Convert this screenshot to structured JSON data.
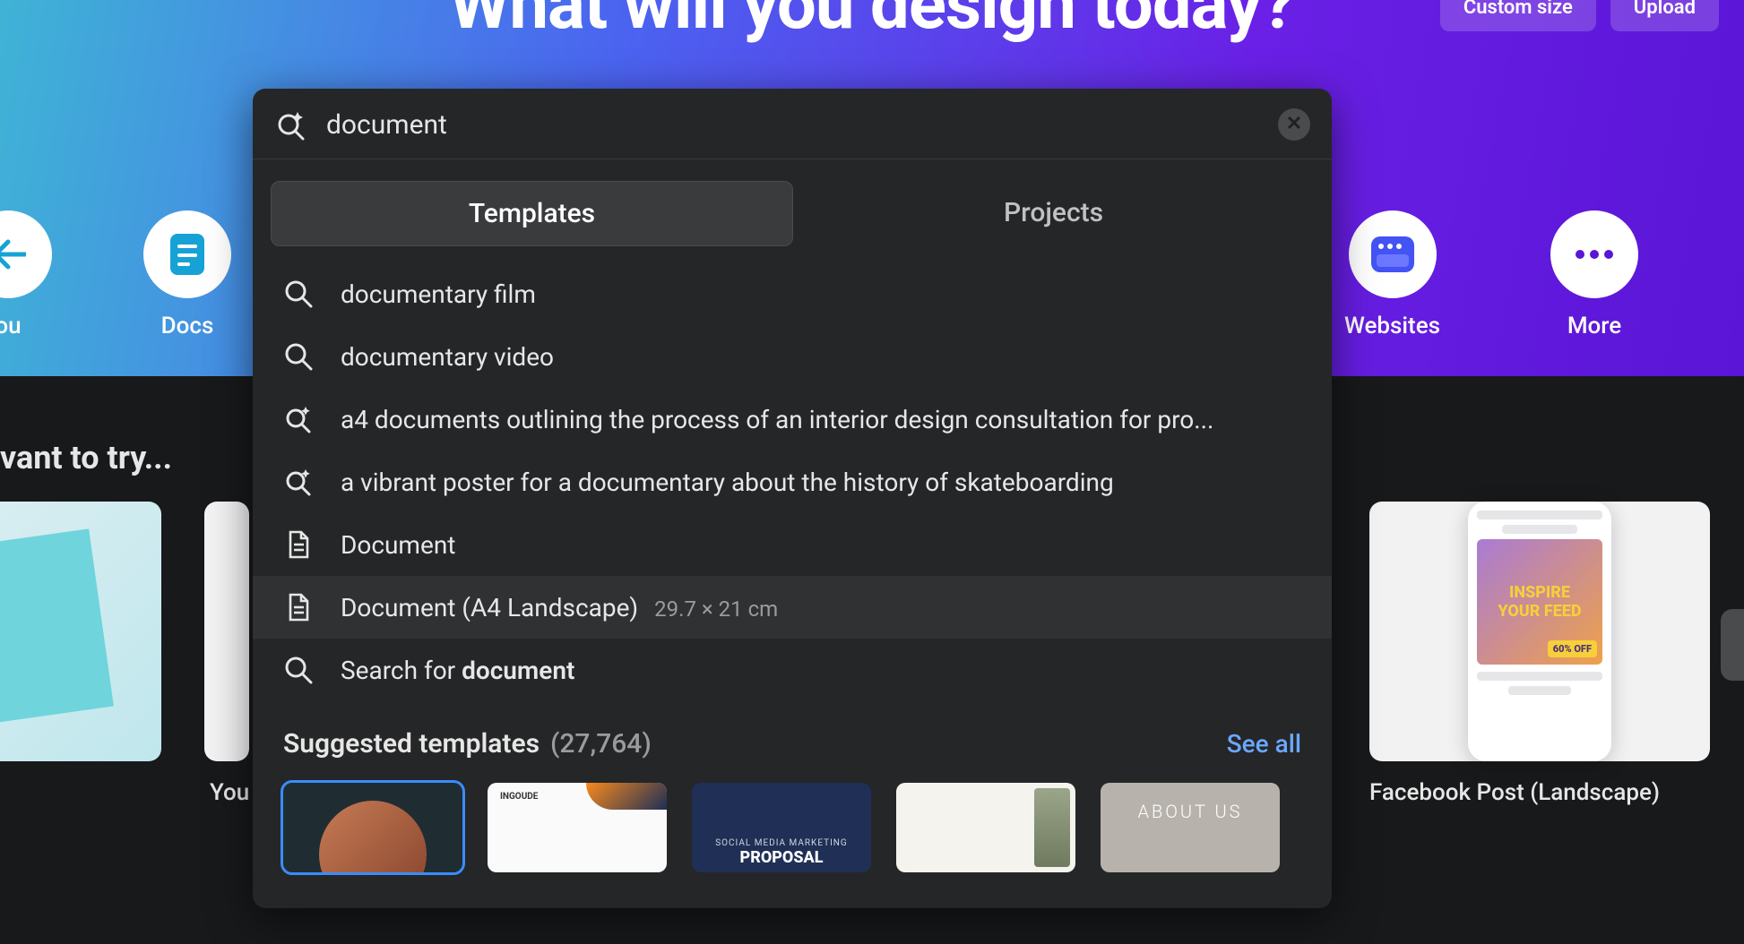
{
  "hero": {
    "title": "What will you design today?",
    "custom_size": "Custom size",
    "upload": "Upload"
  },
  "categories": {
    "you": "ou",
    "docs": "Docs",
    "websites": "Websites",
    "more": "More"
  },
  "section_label": "vant to try...",
  "cards": {
    "b_caption": "You",
    "c_caption": "Facebook Post (Landscape)",
    "phone_line1": "INSPIRE",
    "phone_line2": "YOUR FEED",
    "phone_badge": "60% OFF"
  },
  "search": {
    "value": "document",
    "tabs": {
      "templates": "Templates",
      "projects": "Projects"
    },
    "suggestions": [
      {
        "icon": "search",
        "text": "documentary film"
      },
      {
        "icon": "search",
        "text": "documentary video"
      },
      {
        "icon": "sparkle",
        "text": "a4 documents outlining the process of an interior design consultation for pro..."
      },
      {
        "icon": "sparkle",
        "text": "a vibrant poster for a documentary about the history of skateboarding"
      },
      {
        "icon": "doc",
        "text": "Document"
      },
      {
        "icon": "doc",
        "text": "Document (A4 Landscape)",
        "sub": "29.7 × 21 cm",
        "hover": true
      }
    ],
    "search_for_prefix": "Search for ",
    "search_for_term": "document",
    "templates_header": "Suggested templates",
    "templates_count": "(27,764)",
    "see_all": "See all",
    "tpl2_logo": "INGOUDE",
    "tpl3_a": "SOCIAL MEDIA MARKETING",
    "tpl3_b": "PROPOSAL",
    "tpl5": "ABOUT US"
  }
}
